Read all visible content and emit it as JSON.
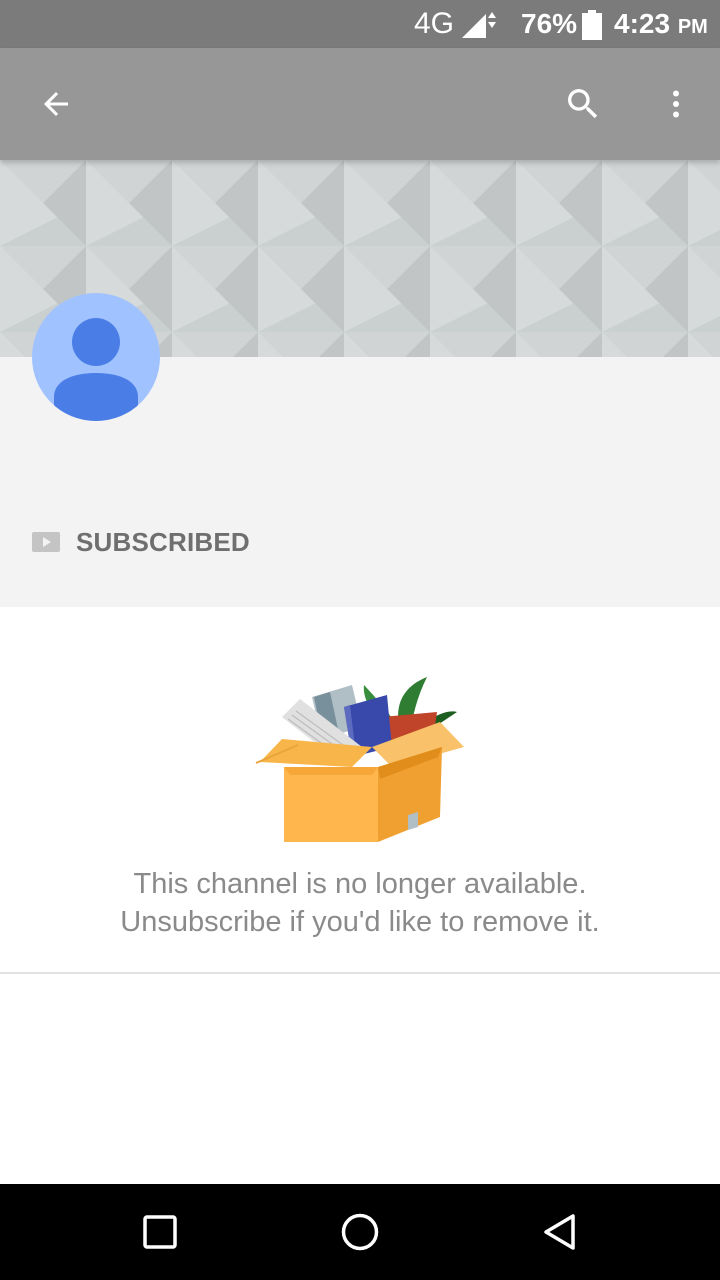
{
  "status_bar": {
    "network": "4G",
    "battery_percent": "76%",
    "time": "4:23",
    "ampm": "PM"
  },
  "app_bar": {
    "icons": {
      "back": "arrow-back-icon",
      "search": "search-icon",
      "more": "more-vert-icon"
    }
  },
  "channel": {
    "subscription_label": "SUBSCRIBED"
  },
  "empty_state": {
    "line1": "This channel is no longer available.",
    "line2": "Unsubscribe if you'd like to remove it."
  },
  "nav_bar": {
    "icons": {
      "recents": "square-recents-icon",
      "home": "circle-home-icon",
      "back": "triangle-back-icon"
    }
  },
  "colors": {
    "status_bar": "#7b7b7b",
    "app_bar": "#979797",
    "avatar_bg": "#a0c3ff",
    "avatar_person": "#4a7ee6",
    "header_bg": "#f3f3f3",
    "message_text": "#8a8a8a",
    "nav_bar": "#000000"
  }
}
